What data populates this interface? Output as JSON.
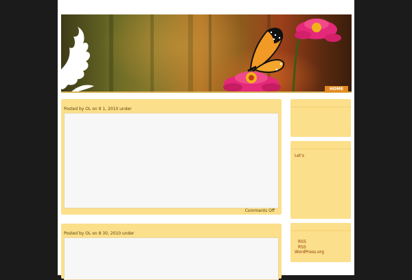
{
  "nav": {
    "home_label": "HOME"
  },
  "posts": [
    {
      "meta": "Posted by OL on 9 1, 2010 under",
      "comments": "Comments Off"
    },
    {
      "meta": "Posted by OL on 8 30, 2010 under"
    }
  ],
  "sidebar": {
    "widget2_text": "Let's",
    "meta_links": [
      "RSS",
      "RSS",
      "WordPress.org"
    ]
  },
  "colors": {
    "background": "#1b1b1b",
    "panel": "#fcdf8a",
    "accent": "#e58a1f",
    "link": "#8a3a0a"
  }
}
